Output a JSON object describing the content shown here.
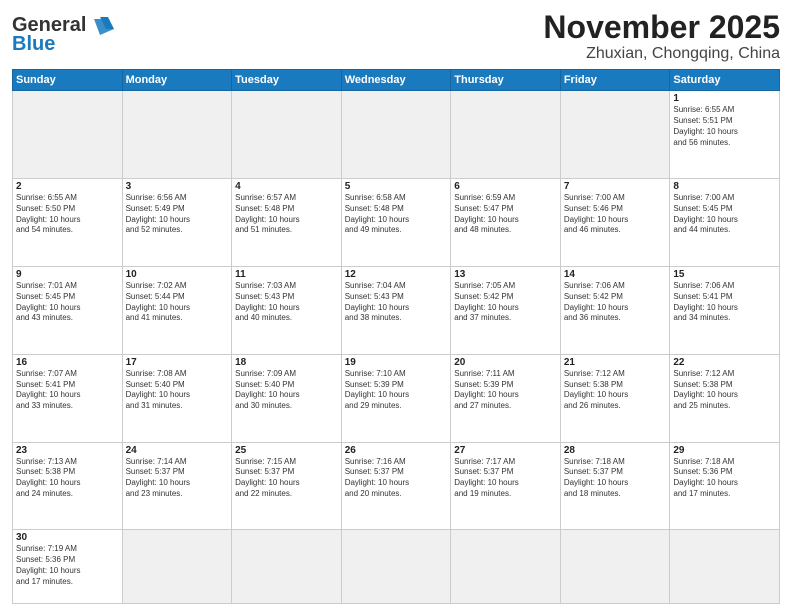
{
  "header": {
    "logo_general": "General",
    "logo_blue": "Blue",
    "month_title": "November 2025",
    "location": "Zhuxian, Chongqing, China"
  },
  "weekdays": [
    "Sunday",
    "Monday",
    "Tuesday",
    "Wednesday",
    "Thursday",
    "Friday",
    "Saturday"
  ],
  "days": [
    {
      "num": "",
      "info": "",
      "empty": true
    },
    {
      "num": "",
      "info": "",
      "empty": true
    },
    {
      "num": "",
      "info": "",
      "empty": true
    },
    {
      "num": "",
      "info": "",
      "empty": true
    },
    {
      "num": "",
      "info": "",
      "empty": true
    },
    {
      "num": "",
      "info": "",
      "empty": true
    },
    {
      "num": "1",
      "info": "Sunrise: 6:55 AM\nSunset: 5:51 PM\nDaylight: 10 hours\nand 56 minutes."
    },
    {
      "num": "2",
      "info": "Sunrise: 6:55 AM\nSunset: 5:50 PM\nDaylight: 10 hours\nand 54 minutes."
    },
    {
      "num": "3",
      "info": "Sunrise: 6:56 AM\nSunset: 5:49 PM\nDaylight: 10 hours\nand 52 minutes."
    },
    {
      "num": "4",
      "info": "Sunrise: 6:57 AM\nSunset: 5:48 PM\nDaylight: 10 hours\nand 51 minutes."
    },
    {
      "num": "5",
      "info": "Sunrise: 6:58 AM\nSunset: 5:48 PM\nDaylight: 10 hours\nand 49 minutes."
    },
    {
      "num": "6",
      "info": "Sunrise: 6:59 AM\nSunset: 5:47 PM\nDaylight: 10 hours\nand 48 minutes."
    },
    {
      "num": "7",
      "info": "Sunrise: 7:00 AM\nSunset: 5:46 PM\nDaylight: 10 hours\nand 46 minutes."
    },
    {
      "num": "8",
      "info": "Sunrise: 7:00 AM\nSunset: 5:45 PM\nDaylight: 10 hours\nand 44 minutes."
    },
    {
      "num": "9",
      "info": "Sunrise: 7:01 AM\nSunset: 5:45 PM\nDaylight: 10 hours\nand 43 minutes."
    },
    {
      "num": "10",
      "info": "Sunrise: 7:02 AM\nSunset: 5:44 PM\nDaylight: 10 hours\nand 41 minutes."
    },
    {
      "num": "11",
      "info": "Sunrise: 7:03 AM\nSunset: 5:43 PM\nDaylight: 10 hours\nand 40 minutes."
    },
    {
      "num": "12",
      "info": "Sunrise: 7:04 AM\nSunset: 5:43 PM\nDaylight: 10 hours\nand 38 minutes."
    },
    {
      "num": "13",
      "info": "Sunrise: 7:05 AM\nSunset: 5:42 PM\nDaylight: 10 hours\nand 37 minutes."
    },
    {
      "num": "14",
      "info": "Sunrise: 7:06 AM\nSunset: 5:42 PM\nDaylight: 10 hours\nand 36 minutes."
    },
    {
      "num": "15",
      "info": "Sunrise: 7:06 AM\nSunset: 5:41 PM\nDaylight: 10 hours\nand 34 minutes."
    },
    {
      "num": "16",
      "info": "Sunrise: 7:07 AM\nSunset: 5:41 PM\nDaylight: 10 hours\nand 33 minutes."
    },
    {
      "num": "17",
      "info": "Sunrise: 7:08 AM\nSunset: 5:40 PM\nDaylight: 10 hours\nand 31 minutes."
    },
    {
      "num": "18",
      "info": "Sunrise: 7:09 AM\nSunset: 5:40 PM\nDaylight: 10 hours\nand 30 minutes."
    },
    {
      "num": "19",
      "info": "Sunrise: 7:10 AM\nSunset: 5:39 PM\nDaylight: 10 hours\nand 29 minutes."
    },
    {
      "num": "20",
      "info": "Sunrise: 7:11 AM\nSunset: 5:39 PM\nDaylight: 10 hours\nand 27 minutes."
    },
    {
      "num": "21",
      "info": "Sunrise: 7:12 AM\nSunset: 5:38 PM\nDaylight: 10 hours\nand 26 minutes."
    },
    {
      "num": "22",
      "info": "Sunrise: 7:12 AM\nSunset: 5:38 PM\nDaylight: 10 hours\nand 25 minutes."
    },
    {
      "num": "23",
      "info": "Sunrise: 7:13 AM\nSunset: 5:38 PM\nDaylight: 10 hours\nand 24 minutes."
    },
    {
      "num": "24",
      "info": "Sunrise: 7:14 AM\nSunset: 5:37 PM\nDaylight: 10 hours\nand 23 minutes."
    },
    {
      "num": "25",
      "info": "Sunrise: 7:15 AM\nSunset: 5:37 PM\nDaylight: 10 hours\nand 22 minutes."
    },
    {
      "num": "26",
      "info": "Sunrise: 7:16 AM\nSunset: 5:37 PM\nDaylight: 10 hours\nand 20 minutes."
    },
    {
      "num": "27",
      "info": "Sunrise: 7:17 AM\nSunset: 5:37 PM\nDaylight: 10 hours\nand 19 minutes."
    },
    {
      "num": "28",
      "info": "Sunrise: 7:18 AM\nSunset: 5:37 PM\nDaylight: 10 hours\nand 18 minutes."
    },
    {
      "num": "29",
      "info": "Sunrise: 7:18 AM\nSunset: 5:36 PM\nDaylight: 10 hours\nand 17 minutes."
    },
    {
      "num": "30",
      "info": "Sunrise: 7:19 AM\nSunset: 5:36 PM\nDaylight: 10 hours\nand 17 minutes."
    },
    {
      "num": "",
      "info": "",
      "empty": true
    },
    {
      "num": "",
      "info": "",
      "empty": true
    },
    {
      "num": "",
      "info": "",
      "empty": true
    },
    {
      "num": "",
      "info": "",
      "empty": true
    },
    {
      "num": "",
      "info": "",
      "empty": true
    },
    {
      "num": "",
      "info": "",
      "empty": true
    }
  ]
}
